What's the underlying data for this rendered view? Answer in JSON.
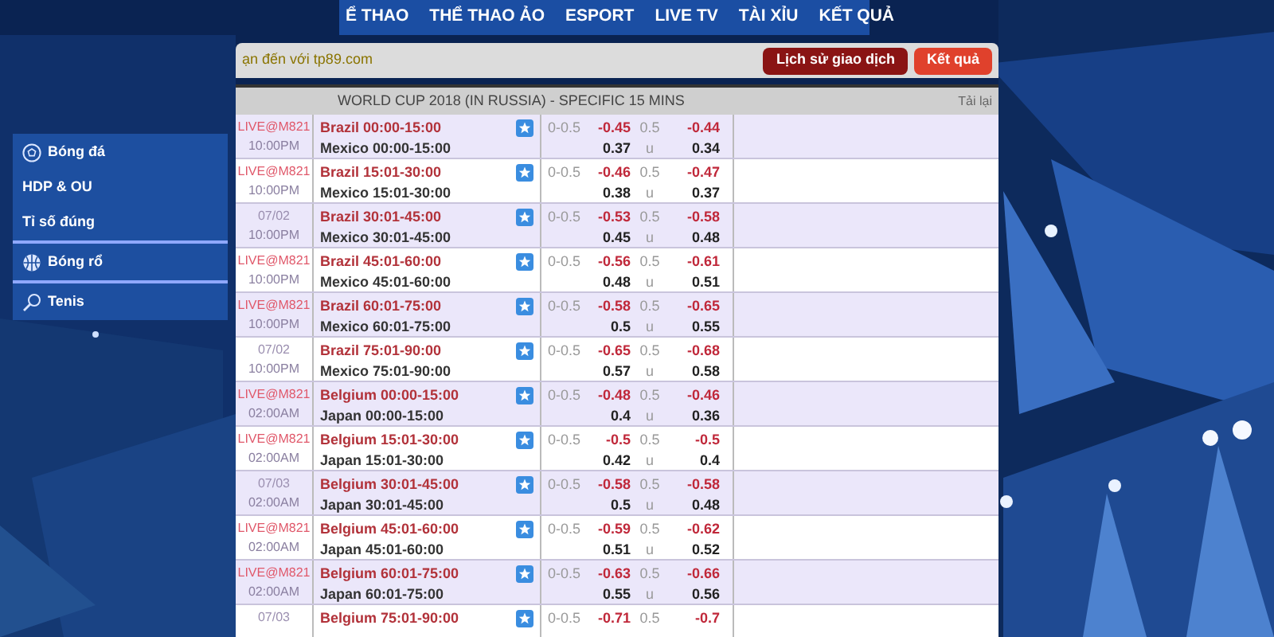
{
  "nav": {
    "items": [
      {
        "label": "Ể THAO"
      },
      {
        "label": "THỂ THAO ẢO"
      },
      {
        "label": "ESPORT"
      },
      {
        "label": "LIVE TV"
      },
      {
        "label": "TÀI XỈU"
      },
      {
        "label": "KẾT QUẢ"
      }
    ]
  },
  "marquee": {
    "text": "ạn đến với tp89.com"
  },
  "buttons": [
    {
      "label": "Lịch sử giao dịch",
      "kind": "dark"
    },
    {
      "label": "Kết quả",
      "kind": "light"
    }
  ],
  "sidebar": {
    "sections": [
      {
        "kind": "soccer",
        "title": "Bóng đá",
        "items": [
          "HDP & OU",
          "Tỉ số đúng"
        ]
      },
      {
        "kind": "basketball",
        "title": "Bóng rổ"
      },
      {
        "kind": "tennis",
        "title": "Tenis"
      }
    ]
  },
  "table": {
    "title": "WORLD CUP 2018 (IN RUSSIA) - SPECIFIC 15 MINS",
    "reload": "Tải lại",
    "rows": [
      {
        "live": true,
        "time_top": "LIVE@M821",
        "time_bottom": "10:00PM",
        "home": "Brazil 00:00-15:00",
        "away": "Mexico 00:00-15:00",
        "hdp": "0-0.5",
        "home_odds": "-0.45",
        "away_odds": "0.37",
        "ou_line": "0.5",
        "ou_label": "u",
        "over_odds": "-0.44",
        "under_odds": "0.34"
      },
      {
        "live": true,
        "time_top": "LIVE@M821",
        "time_bottom": "10:00PM",
        "home": "Brazil 15:01-30:00",
        "away": "Mexico 15:01-30:00",
        "hdp": "0-0.5",
        "home_odds": "-0.46",
        "away_odds": "0.38",
        "ou_line": "0.5",
        "ou_label": "u",
        "over_odds": "-0.47",
        "under_odds": "0.37"
      },
      {
        "live": false,
        "time_top": "07/02",
        "time_bottom": "10:00PM",
        "home": "Brazil 30:01-45:00",
        "away": "Mexico 30:01-45:00",
        "hdp": "0-0.5",
        "home_odds": "-0.53",
        "away_odds": "0.45",
        "ou_line": "0.5",
        "ou_label": "u",
        "over_odds": "-0.58",
        "under_odds": "0.48"
      },
      {
        "live": true,
        "time_top": "LIVE@M821",
        "time_bottom": "10:00PM",
        "home": "Brazil 45:01-60:00",
        "away": "Mexico 45:01-60:00",
        "hdp": "0-0.5",
        "home_odds": "-0.56",
        "away_odds": "0.48",
        "ou_line": "0.5",
        "ou_label": "u",
        "over_odds": "-0.61",
        "under_odds": "0.51"
      },
      {
        "live": true,
        "time_top": "LIVE@M821",
        "time_bottom": "10:00PM",
        "home": "Brazil 60:01-75:00",
        "away": "Mexico 60:01-75:00",
        "hdp": "0-0.5",
        "home_odds": "-0.58",
        "away_odds": "0.5",
        "ou_line": "0.5",
        "ou_label": "u",
        "over_odds": "-0.65",
        "under_odds": "0.55"
      },
      {
        "live": false,
        "time_top": "07/02",
        "time_bottom": "10:00PM",
        "home": "Brazil 75:01-90:00",
        "away": "Mexico 75:01-90:00",
        "hdp": "0-0.5",
        "home_odds": "-0.65",
        "away_odds": "0.57",
        "ou_line": "0.5",
        "ou_label": "u",
        "over_odds": "-0.68",
        "under_odds": "0.58"
      },
      {
        "live": true,
        "time_top": "LIVE@M821",
        "time_bottom": "02:00AM",
        "home": "Belgium 00:00-15:00",
        "away": "Japan 00:00-15:00",
        "hdp": "0-0.5",
        "home_odds": "-0.48",
        "away_odds": "0.4",
        "ou_line": "0.5",
        "ou_label": "u",
        "over_odds": "-0.46",
        "under_odds": "0.36"
      },
      {
        "live": true,
        "time_top": "LIVE@M821",
        "time_bottom": "02:00AM",
        "home": "Belgium 15:01-30:00",
        "away": "Japan 15:01-30:00",
        "hdp": "0-0.5",
        "home_odds": "-0.5",
        "away_odds": "0.42",
        "ou_line": "0.5",
        "ou_label": "u",
        "over_odds": "-0.5",
        "under_odds": "0.4"
      },
      {
        "live": false,
        "time_top": "07/03",
        "time_bottom": "02:00AM",
        "home": "Belgium 30:01-45:00",
        "away": "Japan 30:01-45:00",
        "hdp": "0-0.5",
        "home_odds": "-0.58",
        "away_odds": "0.5",
        "ou_line": "0.5",
        "ou_label": "u",
        "over_odds": "-0.58",
        "under_odds": "0.48"
      },
      {
        "live": true,
        "time_top": "LIVE@M821",
        "time_bottom": "02:00AM",
        "home": "Belgium 45:01-60:00",
        "away": "Japan 45:01-60:00",
        "hdp": "0-0.5",
        "home_odds": "-0.59",
        "away_odds": "0.51",
        "ou_line": "0.5",
        "ou_label": "u",
        "over_odds": "-0.62",
        "under_odds": "0.52"
      },
      {
        "live": true,
        "time_top": "LIVE@M821",
        "time_bottom": "02:00AM",
        "home": "Belgium 60:01-75:00",
        "away": "Japan 60:01-75:00",
        "hdp": "0-0.5",
        "home_odds": "-0.63",
        "away_odds": "0.55",
        "ou_line": "0.5",
        "ou_label": "u",
        "over_odds": "-0.66",
        "under_odds": "0.56"
      },
      {
        "live": false,
        "time_top": "07/03",
        "home": "Belgium 75:01-90:00",
        "hdp": "0-0.5",
        "home_odds": "-0.71",
        "ou_line": "0.5",
        "over_odds": "-0.7"
      }
    ]
  }
}
